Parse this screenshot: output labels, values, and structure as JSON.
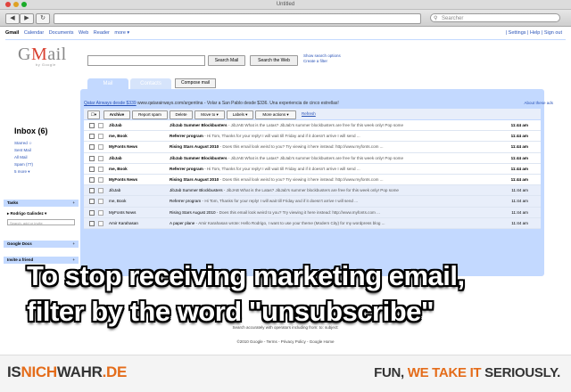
{
  "window": {
    "title": "Untitled"
  },
  "browser": {
    "search_placeholder": "Searcher"
  },
  "gbar": {
    "items": [
      "Gmail",
      "Calendar",
      "Documents",
      "Web",
      "Reader",
      "more ▾"
    ],
    "right": "| Settings | Help | Sign out"
  },
  "logo": {
    "text_g": "G",
    "text_m": "M",
    "text_rest": "ail",
    "sub": "by Google"
  },
  "search": {
    "mail_button": "Search Mail",
    "web_button": "Search the Web",
    "options_link": "Show search options",
    "filter_link": "Create a filter"
  },
  "tabs": {
    "mail": "Mail",
    "contacts": "Contacts",
    "compose": "Compose mail"
  },
  "ad": {
    "link": "Qatar Airways desde $339",
    "url": "www.qatarairways.com/argentina",
    "text": "- Volar a San Pablo desde $336. Una experiencia de cinco estrellas!",
    "right": "About these ads"
  },
  "actions": {
    "archive": "Archive",
    "spam": "Report spam",
    "delete": "Delete",
    "move": "Move to ▾",
    "labels": "Labels ▾",
    "more": "More actions ▾",
    "refresh": "Refresh"
  },
  "nav": {
    "inbox": "Inbox (6)",
    "items": [
      "Starred ☆",
      "Sent Mail",
      "All Mail",
      "Spam (77)",
      "5 more ▾"
    ],
    "tasks": "Tasks",
    "contact": "▸ Rodrigo Galindez ▾",
    "search_ph": "Search, add or invite",
    "google_docs": "Google Docs",
    "invite": "Invite a friend"
  },
  "emails": [
    {
      "from": "JibJab",
      "subject": "JibJab Summer Blockbusters",
      "snippet": " - JibJAB What is the Latas? JibJab's summer blockbusters are free for this week only! Pop some",
      "time": "11:44 am",
      "unread": true
    },
    {
      "from": "me, Book",
      "subject": "Referrer program",
      "snippet": " - Hi Tom, Thanks for your reply! I will wait till Friday and if it doesn't arrive I will send ...",
      "time": "11:44 am",
      "unread": true
    },
    {
      "from": "MyFonts News",
      "subject": "Rising Stars August 2010",
      "snippet": " - Does this email look weird to you? Try viewing it here instead: http://www.myfonts.com ...",
      "time": "11:44 am",
      "unread": true
    },
    {
      "from": "JibJab",
      "subject": "JibJab Summer Blockbusters",
      "snippet": " - JibJAB What is the Latas? JibJab's summer blockbusters are free for this week only! Pop some",
      "time": "11:44 am",
      "unread": true
    },
    {
      "from": "me, Book",
      "subject": "Referrer program",
      "snippet": " - Hi Tom, Thanks for your reply! I will wait till Friday and if it doesn't arrive I will send ...",
      "time": "11:44 am",
      "unread": true
    },
    {
      "from": "MyFonts News",
      "subject": "Rising Stars August 2010",
      "snippet": " - Does this email look weird to you? Try viewing it here instead: http://www.myfonts.com ...",
      "time": "11:44 am",
      "unread": true
    },
    {
      "from": "JibJab",
      "subject": "JibJab Summer Blockbusters",
      "snippet": " - JibJAB What is the Latas? JibJab's summer blockbusters are free for this week only! Pop some",
      "time": "11:44 am",
      "unread": false
    },
    {
      "from": "me, Book",
      "subject": "Referrer program",
      "snippet": " - Hi Tom, Thanks for your reply! I will wait till Friday and if it doesn't arrive I will send ...",
      "time": "11:44 am",
      "unread": false
    },
    {
      "from": "MyFonts News",
      "subject": "Rising Stars August 2010",
      "snippet": " - Does this email look weird to you? Try viewing it here instead: http://www.myfonts.com ...",
      "time": "11:44 am",
      "unread": false
    },
    {
      "from": "Amir Karahasan",
      "subject": "A paper plane",
      "snippet": " - Amir Karahasan wrote: Hello Rodrigo, I want to use your theme (Modern City) for my wordpress blog ...",
      "time": "11:44 am",
      "unread": false
    }
  ],
  "footer": {
    "search_line": "Search accurately with operators including from: to: subject:",
    "copyright": "©2010 Google - Terms - Privacy Policy - Google Home"
  },
  "caption": {
    "line1": "To stop receiving marketing email,",
    "line2": "filter by the word \"unsubscribe\""
  },
  "watermark": {
    "left_a": "IS",
    "left_b": "NICH",
    "left_c": "WAHR",
    "left_d": ".DE",
    "right_a": "FUN, ",
    "right_b": "WE TAKE IT",
    "right_c": " SERIOUSLY."
  }
}
